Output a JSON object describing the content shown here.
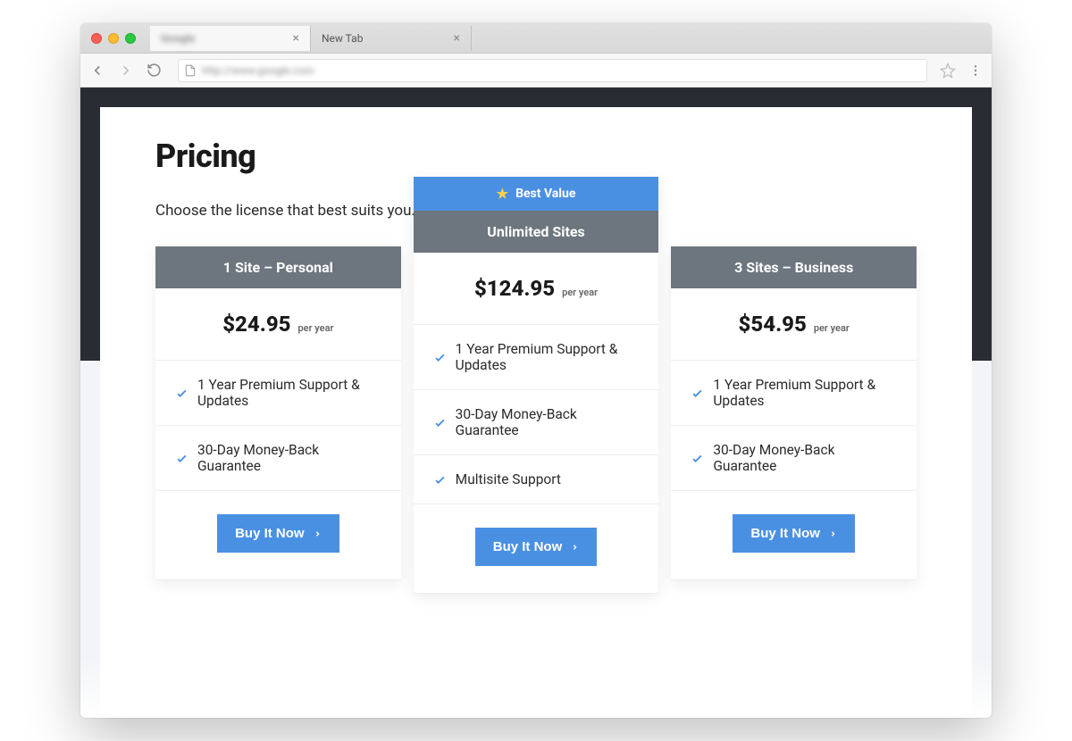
{
  "browser": {
    "tabs": [
      {
        "title": "Google",
        "blurred": true
      },
      {
        "title": "New Tab",
        "blurred": false
      }
    ],
    "url": "http://www.google.com"
  },
  "page": {
    "title": "Pricing",
    "subtitle": "Choose the license that best suits you."
  },
  "plans": [
    {
      "name": "1 Site – Personal",
      "price": "$24.95",
      "period": "per year",
      "badge": null,
      "features": [
        "1 Year Premium Support & Updates",
        "30-Day Money-Back Guarantee"
      ],
      "cta": "Buy It Now"
    },
    {
      "name": "Unlimited Sites",
      "price": "$124.95",
      "period": "per year",
      "badge": "Best Value",
      "features": [
        "1 Year Premium Support & Updates",
        "30-Day Money-Back Guarantee",
        "Multisite Support"
      ],
      "cta": "Buy It Now"
    },
    {
      "name": "3 Sites – Business",
      "price": "$54.95",
      "period": "per year",
      "badge": null,
      "features": [
        "1 Year Premium Support & Updates",
        "30-Day Money-Back Guarantee"
      ],
      "cta": "Buy It Now"
    }
  ]
}
